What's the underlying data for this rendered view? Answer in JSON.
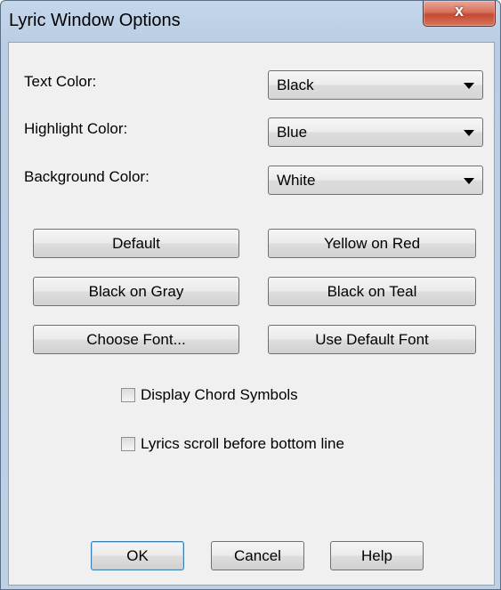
{
  "window": {
    "title": "Lyric Window Options",
    "close_label": "x"
  },
  "fields": [
    {
      "label": "Text Color:",
      "value": "Black"
    },
    {
      "label": "Highlight Color:",
      "value": "Blue"
    },
    {
      "label": "Background Color:",
      "value": "White"
    }
  ],
  "presets": {
    "default": "Default",
    "yellow_on_red": "Yellow on Red",
    "black_on_gray": "Black on Gray",
    "black_on_teal": "Black on Teal",
    "choose_font": "Choose Font...",
    "use_default_font": "Use Default Font"
  },
  "options": {
    "display_chord_symbols": {
      "label": "Display Chord Symbols",
      "checked": false
    },
    "lyrics_scroll": {
      "label": "Lyrics scroll before bottom line",
      "checked": false
    }
  },
  "footer": {
    "ok": "OK",
    "cancel": "Cancel",
    "help": "Help"
  },
  "colors": {
    "titlebar": "#b9cde4",
    "client": "#f0f0f0",
    "close": "#c44a34",
    "default_border": "#3c7fb1"
  }
}
